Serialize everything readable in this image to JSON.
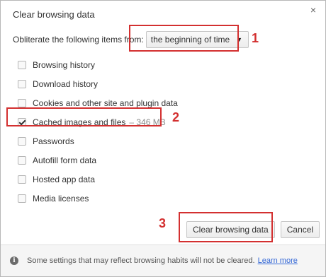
{
  "dialog": {
    "title": "Clear browsing data",
    "close_icon": "×"
  },
  "obliterate": {
    "label": "Obliterate the following items from:",
    "selected_value": "the beginning of time",
    "arrow_icon": "▼"
  },
  "items": [
    {
      "label": "Browsing history",
      "checked": false,
      "note": ""
    },
    {
      "label": "Download history",
      "checked": false,
      "note": ""
    },
    {
      "label": "Cookies and other site and plugin data",
      "checked": false,
      "note": ""
    },
    {
      "label": "Cached images and files",
      "checked": true,
      "note": "– 346 MB"
    },
    {
      "label": "Passwords",
      "checked": false,
      "note": ""
    },
    {
      "label": "Autofill form data",
      "checked": false,
      "note": ""
    },
    {
      "label": "Hosted app data",
      "checked": false,
      "note": ""
    },
    {
      "label": "Media licenses",
      "checked": false,
      "note": ""
    }
  ],
  "buttons": {
    "clear_label": "Clear browsing data",
    "cancel_label": "Cancel"
  },
  "footer": {
    "message": "Some settings that may reflect browsing habits will not be cleared.",
    "learn_more": "Learn more",
    "info_icon": "i"
  },
  "annotations": {
    "step1": "1",
    "step2": "2",
    "step3": "3",
    "color": "#d33030"
  }
}
